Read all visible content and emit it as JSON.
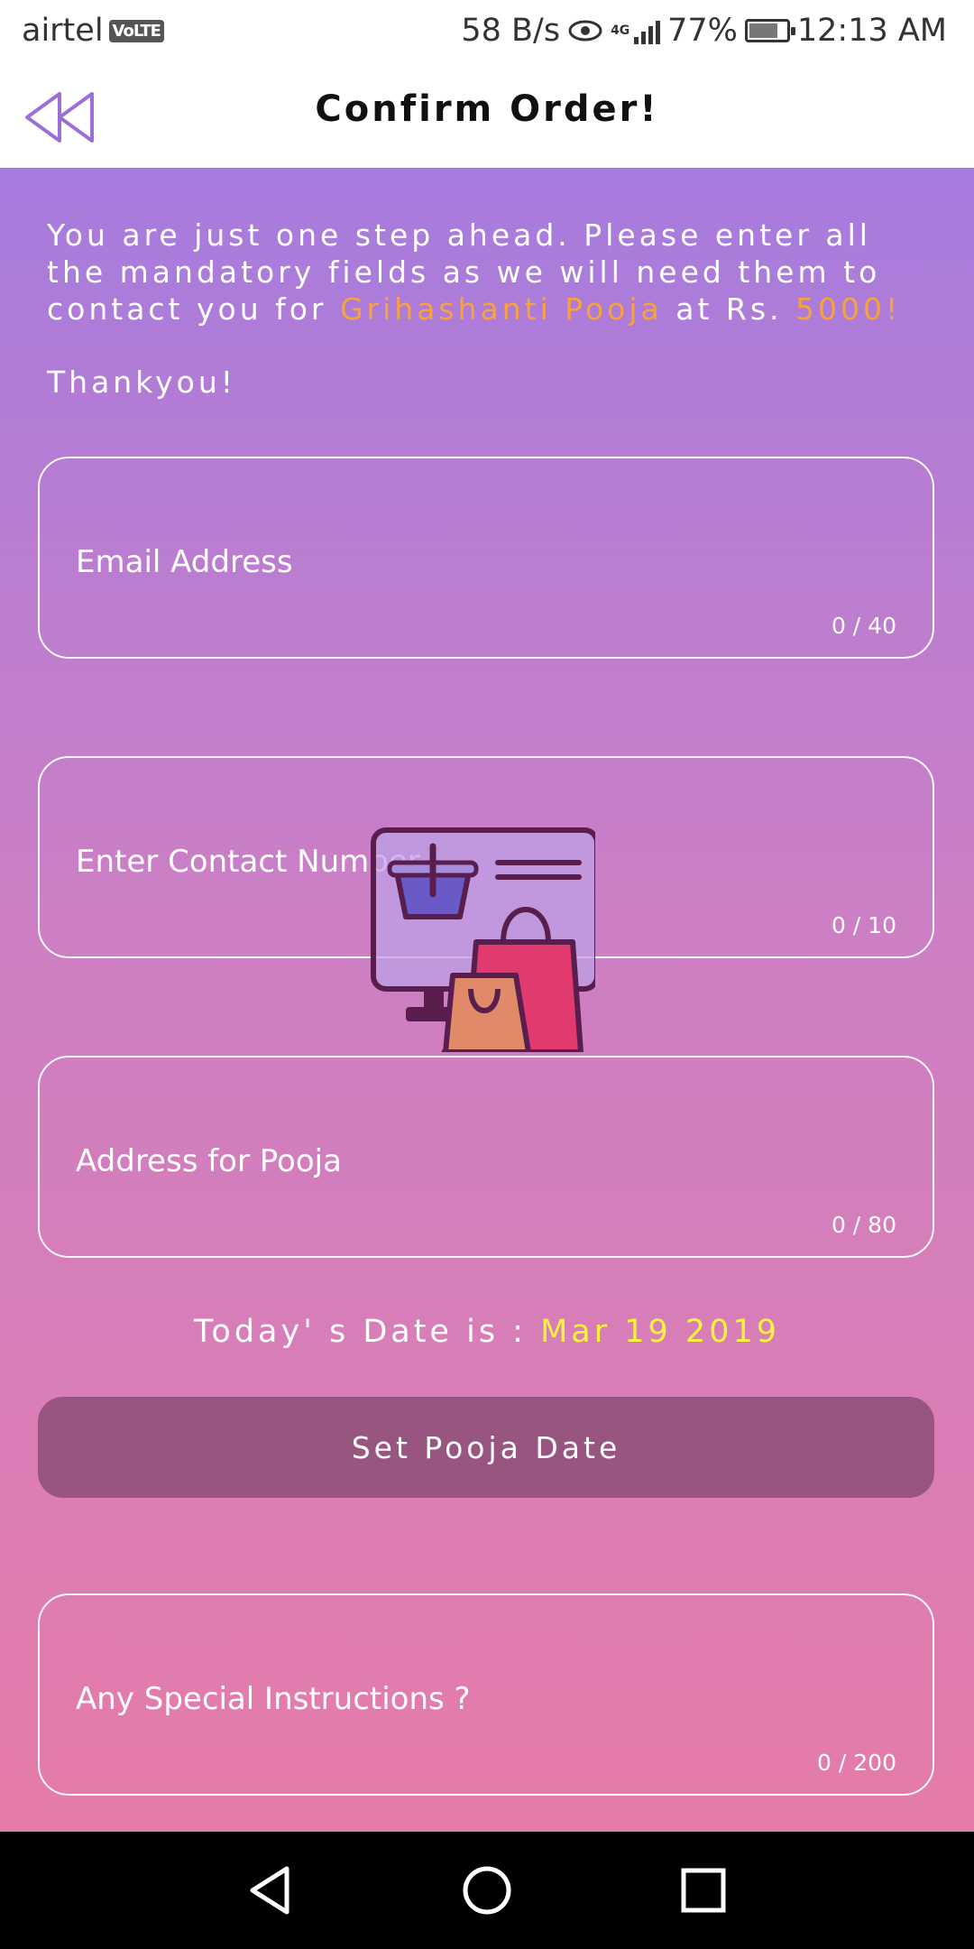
{
  "status_bar": {
    "carrier": "airtel",
    "volte": "VoLTE",
    "speed": "58 B/s",
    "network": "4G",
    "battery_percent": "77%",
    "battery_level": 0.77,
    "time": "12:13 AM"
  },
  "toolbar": {
    "title": "Confirm Order!"
  },
  "intro": {
    "part1": "You are just one step ahead. Please enter all the mandatory fields as we will need them to contact you for ",
    "service_name": "Grihashanti Pooja",
    "part2": " at Rs. ",
    "price": "5000!",
    "thanks": "Thankyou!"
  },
  "fields": {
    "email": {
      "hint": "Email Address",
      "counter": "0 / 40"
    },
    "contact": {
      "hint": "Enter Contact Number",
      "counter": "0 / 10"
    },
    "address": {
      "hint": "Address for Pooja",
      "counter": "0 / 80"
    },
    "instructions": {
      "hint": "Any Special Instructions ?",
      "counter": "0 / 200"
    }
  },
  "date": {
    "label": "Today' s Date is : ",
    "value": "Mar 19 2019"
  },
  "buttons": {
    "set_pooja_date": "Set Pooja Date"
  },
  "colors": {
    "accent_orange": "#f7a23d",
    "date_yellow": "#fff23a",
    "button_bg": "#985580",
    "gradient_top": "#a67bde",
    "gradient_bottom": "#e57ca9"
  },
  "icons": {
    "back": "rewind-back-icon",
    "center_graphic": "online-shopping-icon",
    "nav_back": "triangle-back-icon",
    "nav_home": "circle-home-icon",
    "nav_recents": "square-recents-icon"
  }
}
